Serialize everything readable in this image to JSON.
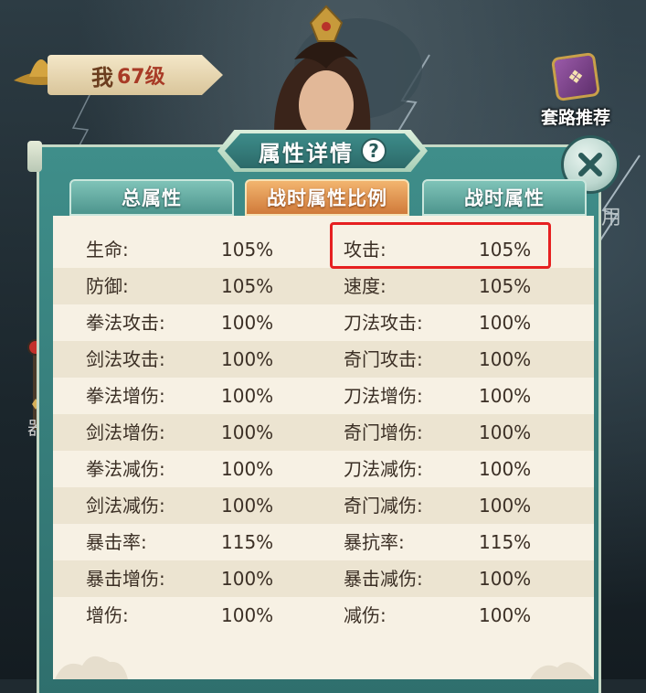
{
  "player": {
    "name": "我",
    "level": "67级"
  },
  "recommend": {
    "label": "套路推荐",
    "icon": "route-book-icon"
  },
  "side": {
    "label": "器"
  },
  "right_fragment": "用",
  "dialog": {
    "title": "属性详情",
    "help": "?",
    "tabs": [
      {
        "label": "总属性",
        "active": false
      },
      {
        "label": "战时属性比例",
        "active": true
      },
      {
        "label": "战时属性",
        "active": false
      }
    ],
    "rows": [
      {
        "l_label": "生命:",
        "l_val": "105%",
        "r_label": "攻击:",
        "r_val": "105%"
      },
      {
        "l_label": "防御:",
        "l_val": "105%",
        "r_label": "速度:",
        "r_val": "105%"
      },
      {
        "l_label": "拳法攻击:",
        "l_val": "100%",
        "r_label": "刀法攻击:",
        "r_val": "100%"
      },
      {
        "l_label": "剑法攻击:",
        "l_val": "100%",
        "r_label": "奇门攻击:",
        "r_val": "100%"
      },
      {
        "l_label": "拳法增伤:",
        "l_val": "100%",
        "r_label": "刀法增伤:",
        "r_val": "100%"
      },
      {
        "l_label": "剑法增伤:",
        "l_val": "100%",
        "r_label": "奇门增伤:",
        "r_val": "100%"
      },
      {
        "l_label": "拳法减伤:",
        "l_val": "100%",
        "r_label": "刀法减伤:",
        "r_val": "100%"
      },
      {
        "l_label": "剑法减伤:",
        "l_val": "100%",
        "r_label": "奇门减伤:",
        "r_val": "100%"
      },
      {
        "l_label": "暴击率:",
        "l_val": "115%",
        "r_label": "暴抗率:",
        "r_val": "115%"
      },
      {
        "l_label": "暴击增伤:",
        "l_val": "100%",
        "r_label": "暴击减伤:",
        "r_val": "100%"
      },
      {
        "l_label": "增伤:",
        "l_val": "100%",
        "r_label": "减伤:",
        "r_val": "100%"
      }
    ]
  },
  "colors": {
    "highlight": "#e62020",
    "active_tab": "#d07a3a",
    "panel": "#3f8e8a"
  }
}
